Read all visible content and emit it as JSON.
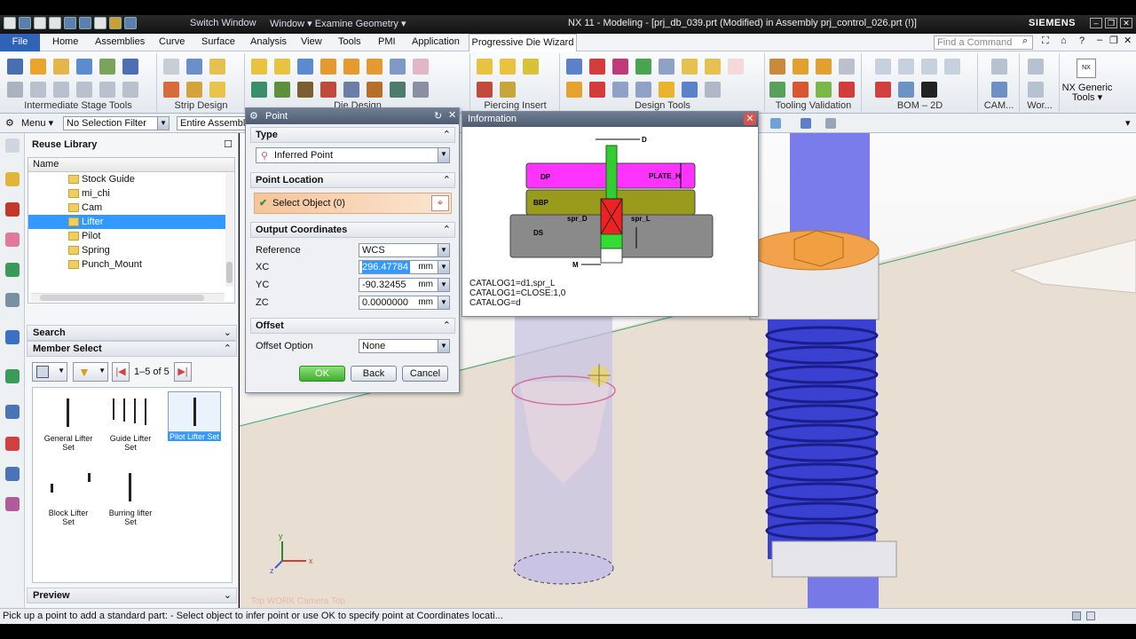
{
  "titlebar": {
    "switch_window": "Switch Window",
    "window_menu": "Window",
    "examine_geometry": "Examine Geometry",
    "app_title": "NX 11 - Modeling - [prj_db_039.prt (Modified)  in Assembly prj_control_026.prt  (!)]",
    "brand": "SIEMENS"
  },
  "menubar": {
    "file": "File",
    "tabs": [
      "Home",
      "Assemblies",
      "Curve",
      "Surface",
      "Analysis",
      "View",
      "Tools",
      "PMI",
      "Application"
    ],
    "active_tab": "Progressive Die Wizard",
    "find_placeholder": "Find a Command"
  },
  "ribbon": {
    "groups": [
      "Intermediate Stage Tools",
      "Strip Design",
      "Die Design",
      "Piercing Insert",
      "Design Tools",
      "Tooling Validation",
      "BOM – 2D",
      "CAM...",
      "Wor..."
    ],
    "nx_generic": "NX Generic Tools",
    "nx_badge": "NX"
  },
  "selbar": {
    "menu": "Menu",
    "filter": "No Selection Filter",
    "scope": "Entire Assembly"
  },
  "navigator": {
    "title": "Reuse Library",
    "name_col": "Name",
    "folders": [
      "Stock Guide",
      "mi_chi",
      "Cam",
      "Lifter",
      "Pilot",
      "Spring",
      "Punch_Mount"
    ],
    "selected_folder": "Lifter",
    "search": "Search",
    "member_select": "Member Select",
    "range": "1–5 of 5",
    "parts": [
      "General Lifter Set",
      "Guide Lifter Set",
      "Pilot Lifter Set",
      "Block Lifter Set",
      "Burring lifter Set"
    ],
    "selected_part": "Pilot Lifter Set",
    "preview": "Preview"
  },
  "point_dialog": {
    "title": "Point",
    "type_section": "Type",
    "type_value": "Inferred Point",
    "location_section": "Point Location",
    "select_object": "Select Object (0)",
    "output_section": "Output Coordinates",
    "reference_label": "Reference",
    "reference_value": "WCS",
    "xc_label": "XC",
    "xc_value": "296.47784",
    "yc_label": "YC",
    "yc_value": "-90.32455",
    "zc_label": "ZC",
    "zc_value": "0.0000000",
    "unit": "mm",
    "offset_section": "Offset",
    "offset_option_label": "Offset Option",
    "offset_option_value": "None",
    "ok": "OK",
    "back": "Back",
    "cancel": "Cancel"
  },
  "info_dialog": {
    "title": "Information",
    "labels": {
      "d": "D",
      "plate_h": "PLATE_H",
      "dp": "DP",
      "bbp": "BBP",
      "spr_d": "spr_D",
      "spr_l": "spr_L",
      "ds": "DS",
      "m": "M"
    },
    "catalog_text": "CATALOG1=d1,spr_L\nCATALOG1=CLOSE:1,0\nCATALOG=d"
  },
  "viewport": {
    "view_label": "Top WORK Camera Top",
    "axis_x": "x",
    "axis_y": "y",
    "axis_z": "z"
  },
  "status": {
    "text": "Pick up a point to add a standard part:  - Select object to infer point or use OK to specify point at Coordinates locati..."
  },
  "colors": {
    "accent": "#3399ff",
    "file_tab": "#2f63b8",
    "dp": "#ff33ff",
    "bbp": "#9a9a1c",
    "ds": "#8a8a8a",
    "spring": "#2a30d8"
  }
}
